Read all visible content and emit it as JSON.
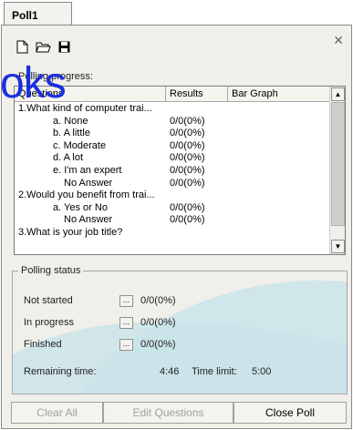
{
  "tab": {
    "title": "Poll1"
  },
  "toolbar": {
    "icons": [
      "new-document-icon",
      "open-folder-icon",
      "save-icon"
    ]
  },
  "watermark": "oks",
  "progress_label": "Polling progress:",
  "list": {
    "columns": [
      "Questions",
      "Results",
      "Bar Graph"
    ],
    "rows": [
      {
        "q": "1.What kind of computer trai...",
        "r": ""
      },
      {
        "q": "a. None",
        "r": "0/0(0%)"
      },
      {
        "q": "b. A little",
        "r": "0/0(0%)"
      },
      {
        "q": "c. Moderate",
        "r": "0/0(0%)"
      },
      {
        "q": "d. A lot",
        "r": "0/0(0%)"
      },
      {
        "q": "e. I'm an expert",
        "r": "0/0(0%)"
      },
      {
        "q": "No Answer",
        "r": "0/0(0%)"
      },
      {
        "q": "2.Would you benefit from trai...",
        "r": ""
      },
      {
        "q": "a. Yes or No",
        "r": "0/0(0%)"
      },
      {
        "q": "No Answer",
        "r": "0/0(0%)"
      },
      {
        "q": "3.What is your job title?",
        "r": ""
      }
    ]
  },
  "status": {
    "title": "Polling status",
    "not_started": {
      "label": "Not started",
      "btn": "...",
      "value": "0/0(0%)"
    },
    "in_progress": {
      "label": "In progress",
      "btn": "...",
      "value": "0/0(0%)"
    },
    "finished": {
      "label": "Finished",
      "btn": "...",
      "value": "0/0(0%)"
    },
    "remaining_label": "Remaining time:",
    "remaining_value": "4:46",
    "limit_label": "Time limit:",
    "limit_value": "5:00"
  },
  "buttons": {
    "clear_all": "Clear All",
    "edit_questions": "Edit Questions",
    "close_poll": "Close Poll"
  },
  "colors": {
    "panel": "#f1efe9",
    "watermark": "#1a2fe0",
    "swoosh": "#c9e4ea"
  }
}
